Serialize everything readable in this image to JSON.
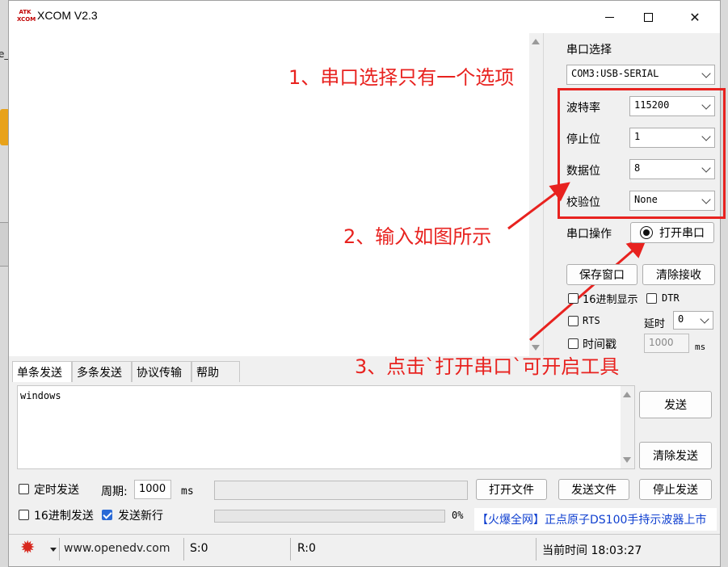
{
  "window": {
    "title": "XCOM V2.3",
    "logo_text": "ATK XCOM"
  },
  "panel": {
    "port_select_label": "串口选择",
    "port_value": "COM3:USB-SERIAL",
    "baud_label": "波特率",
    "baud_value": "115200",
    "stopbit_label": "停止位",
    "stopbit_value": "1",
    "databit_label": "数据位",
    "databit_value": "8",
    "parity_label": "校验位",
    "parity_value": "None",
    "port_op_label": "串口操作",
    "open_port_button": "打开串口",
    "save_window_button": "保存窗口",
    "clear_recv_button": "清除接收",
    "hex_display_label": "16进制显示",
    "dtr_label": "DTR",
    "rts_label": "RTS",
    "delay_label": "延时",
    "delay_value": "0",
    "timestamp_label": "时间戳",
    "timestamp_value": "1000",
    "ms_label": "ms"
  },
  "annotations": {
    "note1": "1、串口选择只有一个选项",
    "note2": "2、输入如图所示",
    "note3": "3、点击`打开串口`可开启工具",
    "accent": "#e8221f"
  },
  "tabs": [
    "单条发送",
    "多条发送",
    "协议传输",
    "帮助"
  ],
  "send": {
    "text": "windows",
    "send_button": "发送",
    "clear_send_button": "清除发送",
    "timed_send_label": "定时发送",
    "period_label": "周期:",
    "period_value": "1000",
    "period_unit": "ms",
    "open_file_button": "打开文件",
    "send_file_button": "发送文件",
    "stop_send_button": "停止发送",
    "hex_send_label": "16进制发送",
    "newline_label": "发送新行",
    "newline_checked": true,
    "progress_text": "0%",
    "progress": 0,
    "ad_text": "【火爆全网】正点原子DS100手持示波器上市"
  },
  "status": {
    "url": "www.openedv.com",
    "sent": "S:0",
    "received": "R:0",
    "time": "当前时间 18:03:27"
  }
}
